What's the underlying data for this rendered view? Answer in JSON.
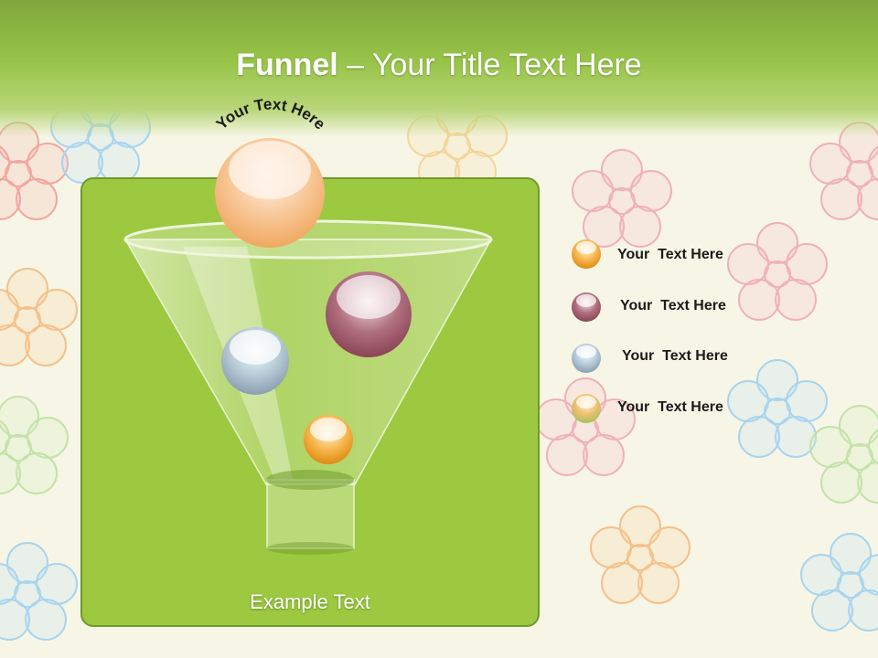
{
  "title": {
    "bold": "Funnel",
    "rest": " – Your Title Text Here"
  },
  "top_arc_text": "Your Text Here",
  "example_text": "Example Text",
  "legend": [
    {
      "label": "Your  Text Here",
      "color": "#f0a030"
    },
    {
      "label": "Your  Text Here",
      "color": "#a05868"
    },
    {
      "label": "Your  Text Here",
      "color": "#9fb4c0"
    },
    {
      "label": "Your  Text Here",
      "color": "#e0b050"
    }
  ],
  "colors": {
    "header": "#8fbc44",
    "panel": "#9cc93f",
    "panel_border": "#6f9a2a"
  }
}
